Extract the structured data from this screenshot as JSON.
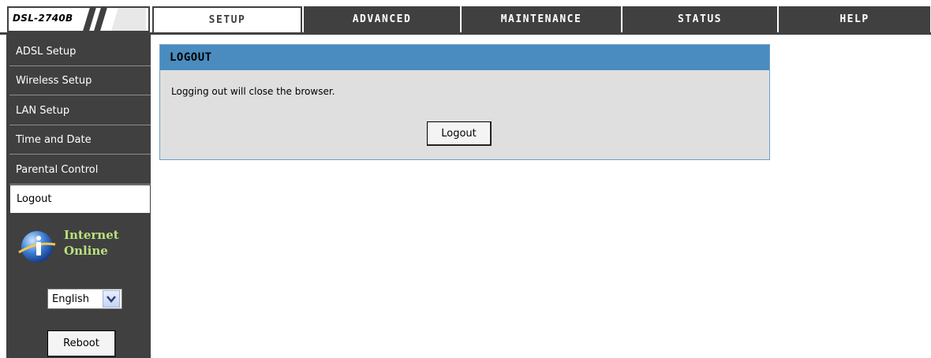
{
  "header": {
    "model": "DSL-2740B",
    "tabs": [
      {
        "label": "SETUP",
        "active": true
      },
      {
        "label": "ADVANCED",
        "active": false
      },
      {
        "label": "MAINTENANCE",
        "active": false
      },
      {
        "label": "STATUS",
        "active": false
      },
      {
        "label": "HELP",
        "active": false
      }
    ]
  },
  "sidebar": {
    "items": [
      {
        "label": "ADSL Setup",
        "active": false
      },
      {
        "label": "Wireless Setup",
        "active": false
      },
      {
        "label": "LAN Setup",
        "active": false
      },
      {
        "label": "Time and Date",
        "active": false
      },
      {
        "label": "Parental Control",
        "active": false
      },
      {
        "label": "Logout",
        "active": true
      }
    ],
    "status_line1": "Internet",
    "status_line2": "Online",
    "language": "English",
    "reboot_label": "Reboot"
  },
  "panel": {
    "title": "LOGOUT",
    "message": "Logging out will close the browser.",
    "button_label": "Logout"
  },
  "colors": {
    "dark": "#404040",
    "panel_header": "#4a8cbf",
    "panel_bg": "#dfdfdf",
    "status_text": "#b9e07c"
  },
  "icons": {
    "status": "info-globe-icon",
    "dropdown": "chevron-down-icon"
  }
}
